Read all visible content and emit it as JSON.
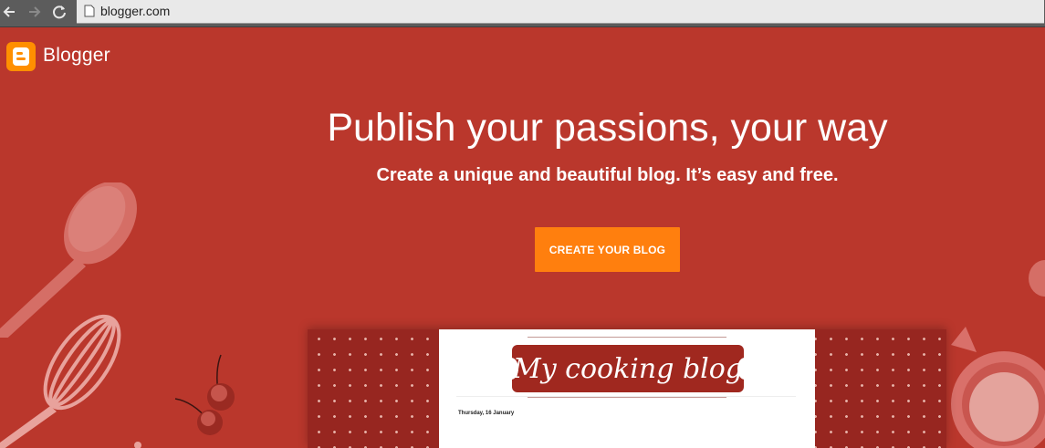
{
  "browser": {
    "url": "blogger.com",
    "icons": [
      "back-icon",
      "forward-icon",
      "reload-icon",
      "page-icon"
    ]
  },
  "header": {
    "brand": "Blogger",
    "logo_icon": "blogger-logo-icon"
  },
  "hero": {
    "headline": "Publish your passions, your way",
    "subheadline": "Create a unique and beautiful blog. It’s easy and free.",
    "cta_label": "CREATE YOUR BLOG"
  },
  "preview": {
    "blog_title": "My cooking blog",
    "post_date": "Thursday, 16 January"
  },
  "colors": {
    "background": "#ba372c",
    "cta": "#ff7f0e",
    "logo": "#ff8f00",
    "pattern": "#972620"
  }
}
